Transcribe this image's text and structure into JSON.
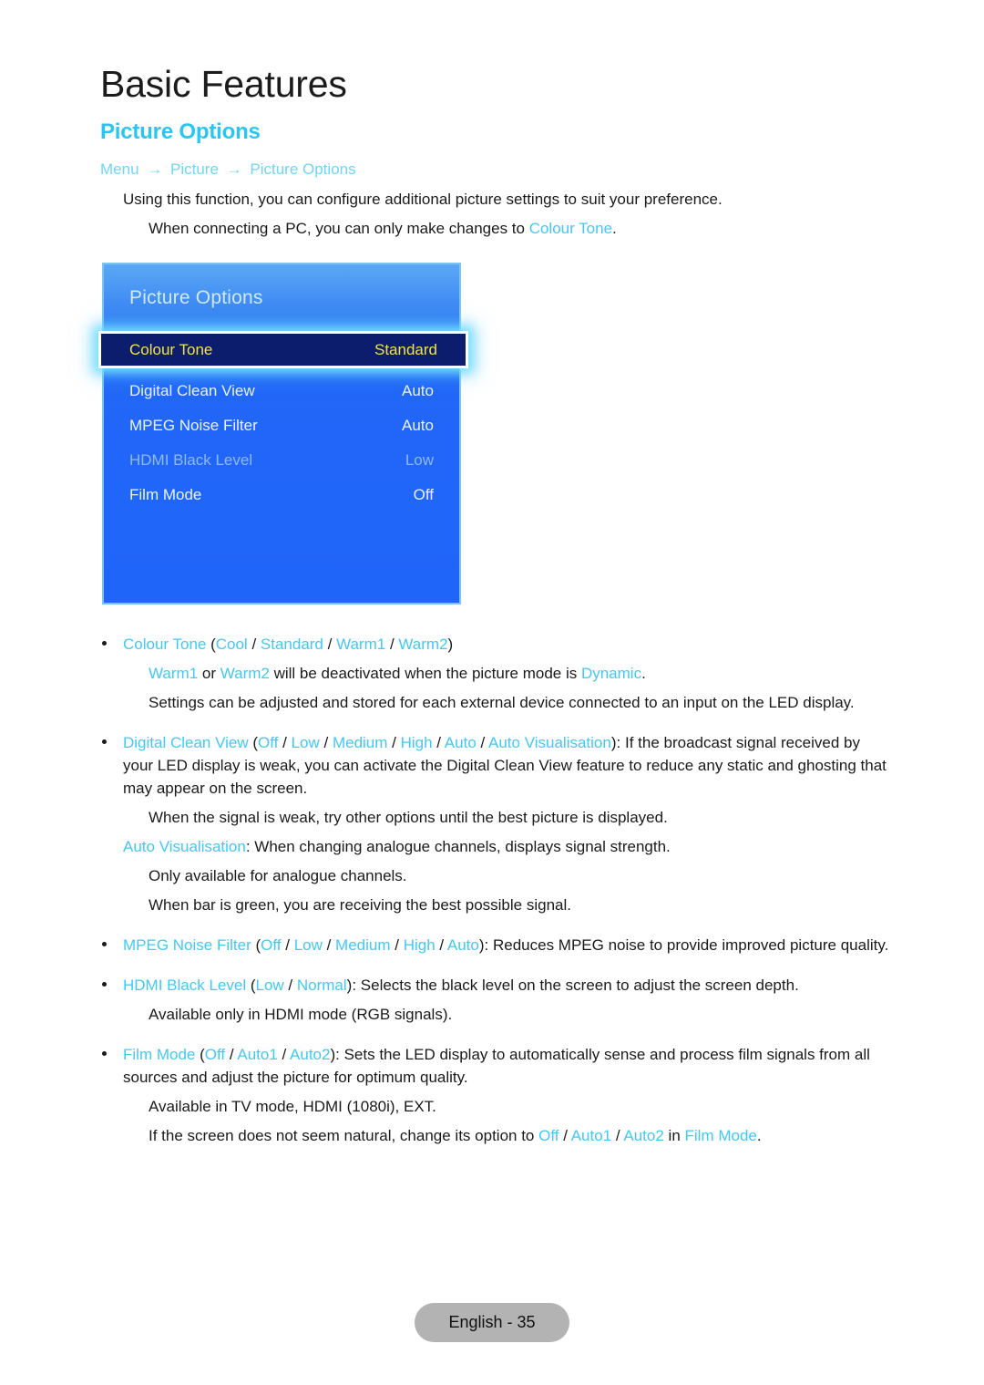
{
  "header": {
    "chapter": "Basic Features",
    "section": "Picture Options",
    "breadcrumb": {
      "items": [
        "Menu",
        "Picture",
        "Picture Options"
      ],
      "separator": "→"
    }
  },
  "intro": {
    "line1": "Using this function, you can configure additional picture settings to suit your preference.",
    "line2_pre": "When connecting a PC, you can only make changes to ",
    "line2_term": "Colour Tone",
    "line2_post": "."
  },
  "osd": {
    "title": "Picture Options",
    "rows": [
      {
        "label": "Colour Tone",
        "value": "Standard",
        "state": "selected"
      },
      {
        "label": "Digital Clean View",
        "value": "Auto",
        "state": "normal"
      },
      {
        "label": "MPEG Noise Filter",
        "value": "Auto",
        "state": "normal"
      },
      {
        "label": "HDMI Black Level",
        "value": "Low",
        "state": "disabled"
      },
      {
        "label": "Film Mode",
        "value": "Off",
        "state": "normal"
      }
    ]
  },
  "colors": {
    "accent_cyan": "#41c9f5",
    "heading_cyan": "#29c6f4",
    "breadcrumb_cyan": "#6ed6f7",
    "osd_blue": "#1f65f9",
    "osd_highlight_bg": "#0d1d6e",
    "osd_highlight_text": "#f2e14a",
    "osd_border": "#7fc4f0",
    "osd_disabled_text": "#8fb9f8",
    "footer_pill_bg": "#b3b3b3",
    "body_text": "#1a1a1a"
  },
  "content": {
    "colour_tone": {
      "term": "Colour Tone",
      "open": " (",
      "options": [
        "Cool",
        "Standard",
        "Warm1",
        "Warm2"
      ],
      "sep": " / ",
      "close": ")",
      "notes": [
        {
          "parts": [
            {
              "t": "Warm1",
              "c": "cy"
            },
            {
              "t": " or ",
              "c": "bk"
            },
            {
              "t": "Warm2",
              "c": "cy"
            },
            {
              "t": " will be deactivated when the picture mode is ",
              "c": "bk"
            },
            {
              "t": "Dynamic",
              "c": "cy"
            },
            {
              "t": ".",
              "c": "bk"
            }
          ]
        },
        {
          "parts": [
            {
              "t": "Settings can be adjusted and stored for each external device connected to an input on the LED display.",
              "c": "bk"
            }
          ]
        }
      ]
    },
    "digital_clean_view": {
      "term": "Digital Clean View",
      "open": " (",
      "options": [
        "Off",
        "Low",
        "Medium",
        "High",
        "Auto",
        "Auto Visualisation"
      ],
      "sep": " / ",
      "close": ")",
      "desc": ": If the broadcast signal received by your LED display is weak, you can activate the Digital Clean View feature to reduce any static and ghosting that may appear on the screen.",
      "notes": [
        {
          "indent": "sub",
          "parts": [
            {
              "t": "When the signal is weak, try other options until the best picture is displayed.",
              "c": "bk"
            }
          ]
        },
        {
          "indent": "flush",
          "parts": [
            {
              "t": "Auto Visualisation",
              "c": "cy"
            },
            {
              "t": ": When changing analogue channels, displays signal strength.",
              "c": "bk"
            }
          ]
        },
        {
          "indent": "sub",
          "parts": [
            {
              "t": "Only available for analogue channels.",
              "c": "bk"
            }
          ]
        },
        {
          "indent": "sub",
          "parts": [
            {
              "t": "When bar is green, you are receiving the best possible signal.",
              "c": "bk"
            }
          ]
        }
      ]
    },
    "mpeg_noise_filter": {
      "term": "MPEG Noise Filter",
      "open": " (",
      "options": [
        "Off",
        "Low",
        "Medium",
        "High",
        "Auto"
      ],
      "sep": " / ",
      "close": ")",
      "desc": ": Reduces MPEG noise to provide improved picture quality."
    },
    "hdmi_black_level": {
      "term": "HDMI Black Level",
      "open": " (",
      "options": [
        "Low",
        "Normal"
      ],
      "sep": " / ",
      "close": ")",
      "desc": ": Selects the black level on the screen to adjust the screen depth.",
      "notes": [
        {
          "indent": "sub",
          "parts": [
            {
              "t": "Available only in HDMI mode (RGB signals).",
              "c": "bk"
            }
          ]
        }
      ]
    },
    "film_mode": {
      "term": "Film Mode",
      "open": " (",
      "options": [
        "Off",
        "Auto1",
        "Auto2"
      ],
      "sep": " / ",
      "close": ")",
      "desc": ": Sets the LED display to automatically sense and process film signals from all sources and adjust the picture for optimum quality.",
      "notes": [
        {
          "indent": "sub",
          "parts": [
            {
              "t": "Available in TV mode, HDMI (1080i), EXT.",
              "c": "bk"
            }
          ]
        },
        {
          "indent": "sub",
          "parts": [
            {
              "t": "If the screen does not seem natural, change its option to ",
              "c": "bk"
            },
            {
              "t": "Off",
              "c": "cy"
            },
            {
              "t": " / ",
              "c": "bk"
            },
            {
              "t": "Auto1",
              "c": "cy"
            },
            {
              "t": " / ",
              "c": "bk"
            },
            {
              "t": "Auto2",
              "c": "cy"
            },
            {
              "t": " in ",
              "c": "bk"
            },
            {
              "t": "Film Mode",
              "c": "cy"
            },
            {
              "t": ".",
              "c": "bk"
            }
          ]
        }
      ]
    }
  },
  "footer": {
    "page_label": "English - 35"
  }
}
